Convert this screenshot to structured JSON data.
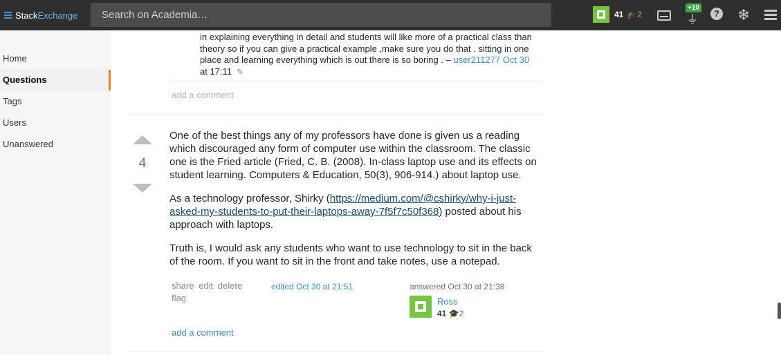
{
  "topbar": {
    "brand_prefix": "Stack",
    "brand_suffix": "Exchange",
    "search_placeholder": "Search on Academia…",
    "user_rep": "41",
    "user_badge_count": "2",
    "achievements_delta": "+10",
    "icons": [
      "hamburger-icon",
      "inbox-icon",
      "achievements-icon",
      "help-icon",
      "stackexchange-icon",
      "menu-icon"
    ]
  },
  "sidebar": {
    "items": [
      {
        "label": "Home"
      },
      {
        "label": "Questions"
      },
      {
        "label": "Tags"
      },
      {
        "label": "Users"
      },
      {
        "label": "Unanswered"
      }
    ]
  },
  "comment": {
    "text": "in explaining everything in detail and students will like more of a practical class than theory so if you can give a practical example ,make sure you do that . sitting in one place and learning everything which is out there is so boring . –",
    "user": "user211277",
    "date": "Oct 30",
    "time": "at 17:11"
  },
  "add_comment_label": "add a comment",
  "answer": {
    "votes": "4",
    "p1": "One of the best things any of my professors have done is given us a reading which discouraged any form of computer use within the classroom. The classic one is the Fried article (Fried, C. B. (2008). In-class laptop use and its effects on student learning. Computers & Education, 50(3), 906-914.) about laptop use.",
    "p2_before": "As a technology professor, Shirky (",
    "p2_link": "https://medium.com/@cshirky/why-i-just-asked-my-students-to-put-their-laptops-away-7f5f7c50f368",
    "p2_after": ") posted about his approach with laptops.",
    "p3": "Truth is, I would ask any students who want to use technology to sit in the back of the room. If you want to sit in the front and take notes, use a notepad.",
    "menu": {
      "share": "share",
      "edit": "edit",
      "delete": "delete",
      "flag": "flag"
    },
    "edited": "edited Oct 30 at 21:51",
    "answered": "answered Oct 30 at 21:38",
    "owner_name": "Ross",
    "owner_rep": "41",
    "owner_badges": "2"
  }
}
